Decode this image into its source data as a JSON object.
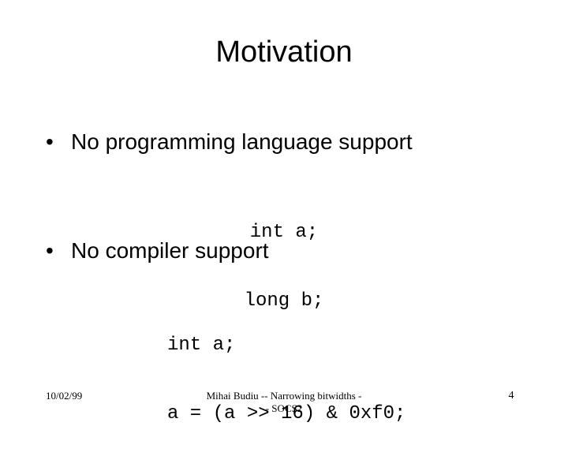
{
  "slide": {
    "title": "Motivation",
    "page_number": "4",
    "background_color": "#ffffff",
    "text_color": "#000000",
    "bullet_glyph": "•",
    "bullets": [
      {
        "marker": "•",
        "text": "No programming language support",
        "code": {
          "align": "center",
          "lines": [
            "int a;",
            "long b;"
          ]
        }
      },
      {
        "marker": "•",
        "text": "No compiler support",
        "code": {
          "align": "left",
          "lines": [
            "int a;",
            "a = (a >> 16) & 0xf0;"
          ]
        }
      }
    ]
  },
  "footer": {
    "date": "10/02/99",
    "center_line1": "Mihai Budiu -- Narrowing bitwidths -",
    "center_line2": "- SOCS2",
    "page": "4"
  }
}
